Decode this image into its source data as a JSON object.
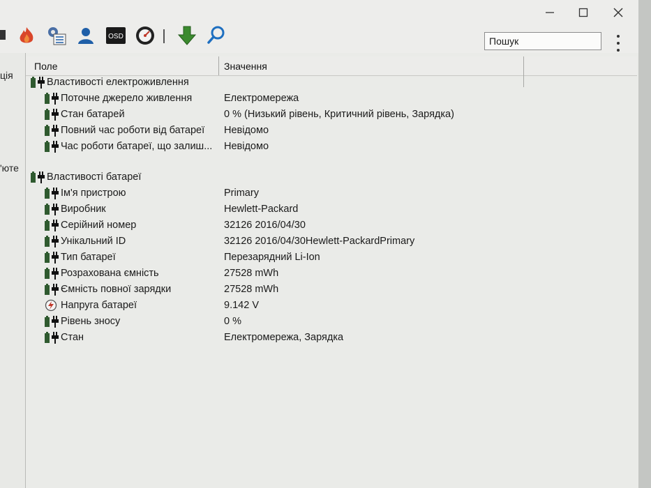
{
  "search": {
    "placeholder": "Пошук"
  },
  "left_pane": {
    "items": [
      "ція",
      "'юте"
    ]
  },
  "columns": {
    "field": "Поле",
    "value": "Значення"
  },
  "groups": [
    {
      "title": "Властивості електроживлення",
      "rows": [
        {
          "field": "Поточне джерело живлення",
          "value": "Електромережа",
          "icon": "battery-plug-icon"
        },
        {
          "field": "Стан батарей",
          "value": "0 % (Низький рівень, Критичний рівень, Зарядка)",
          "icon": "battery-plug-icon"
        },
        {
          "field": "Повний час роботи від батареї",
          "value": "Невідомо",
          "icon": "battery-plug-icon"
        },
        {
          "field": "Час роботи батареї, що залиш...",
          "value": "Невідомо",
          "icon": "battery-plug-icon"
        }
      ]
    },
    {
      "title": "Властивості батареї",
      "rows": [
        {
          "field": "Ім'я пристрою",
          "value": "Primary",
          "icon": "battery-plug-icon"
        },
        {
          "field": "Виробник",
          "value": "Hewlett-Packard",
          "icon": "battery-plug-icon"
        },
        {
          "field": "Серійний номер",
          "value": "32126 2016/04/30",
          "icon": "battery-plug-icon"
        },
        {
          "field": "Унікальний ID",
          "value": "32126 2016/04/30Hewlett-PackardPrimary",
          "icon": "battery-plug-icon"
        },
        {
          "field": "Тип батареї",
          "value": "Перезарядний Li-Ion",
          "icon": "battery-plug-icon"
        },
        {
          "field": "Розрахована ємність",
          "value": "27528 mWh",
          "icon": "battery-plug-icon"
        },
        {
          "field": "Ємність повної зарядки",
          "value": "27528 mWh",
          "icon": "battery-plug-icon"
        },
        {
          "field": "Напруга батареї",
          "value": "9.142 V",
          "icon": "voltage-icon"
        },
        {
          "field": "Рівень зносу",
          "value": "0 %",
          "icon": "battery-plug-icon"
        },
        {
          "field": "Стан",
          "value": "Електромережа, Зарядка",
          "icon": "battery-plug-icon"
        }
      ]
    }
  ],
  "toolbar": {
    "osd_label": "OSD"
  },
  "colors": {
    "battery": "#2f5a2f",
    "plug": "#111111",
    "voltage": "#c0392b",
    "arrow": "#3b8a2e",
    "search_icon": "#1e6fc0",
    "user_icon": "#1f5fa8",
    "flame": "#d9462a"
  }
}
